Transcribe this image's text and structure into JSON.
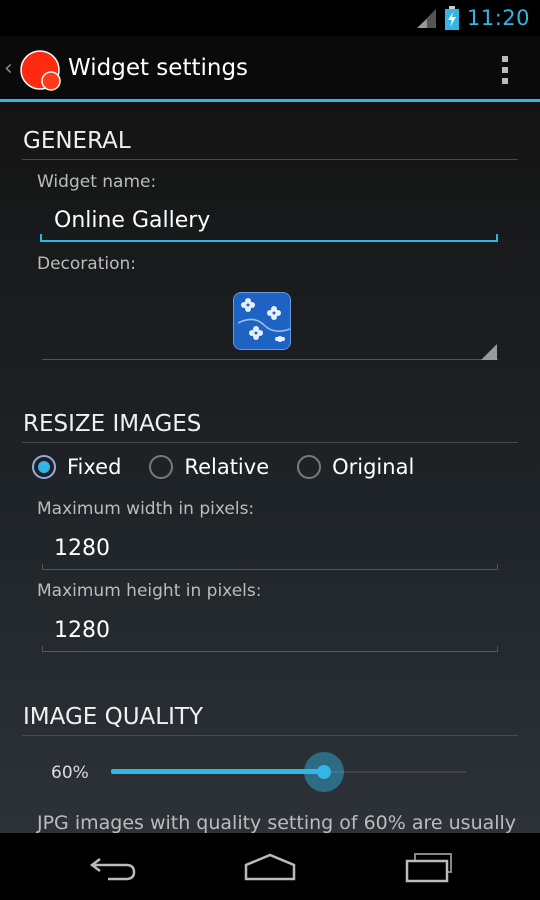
{
  "status_bar": {
    "time": "11:20",
    "signal_icon": "signal-icon",
    "battery_icon": "battery-charging-icon"
  },
  "action_bar": {
    "up_icon": "up-caret-icon",
    "app_icon": "app-logo-icon",
    "title": "Widget settings",
    "overflow_icon": "overflow-menu-icon"
  },
  "general": {
    "header": "GENERAL",
    "widget_name_label": "Widget name:",
    "widget_name_value": "Online Gallery",
    "decoration_label": "Decoration:",
    "decoration_icon": "floral-pattern-thumbnail"
  },
  "resize": {
    "header": "RESIZE IMAGES",
    "options": [
      {
        "label": "Fixed",
        "checked": true
      },
      {
        "label": "Relative",
        "checked": false
      },
      {
        "label": "Original",
        "checked": false
      }
    ],
    "max_width_label": "Maximum width in pixels:",
    "max_width_value": "1280",
    "max_height_label": "Maximum height in pixels:",
    "max_height_value": "1280"
  },
  "quality": {
    "header": "IMAGE QUALITY",
    "value_label": "60%",
    "value": 60,
    "hint": "JPG images with quality setting of 60% are usually"
  },
  "nav_bar": {
    "back_icon": "back-icon",
    "home_icon": "home-icon",
    "recents_icon": "recents-icon"
  },
  "colors": {
    "accent": "#33b5e5"
  }
}
